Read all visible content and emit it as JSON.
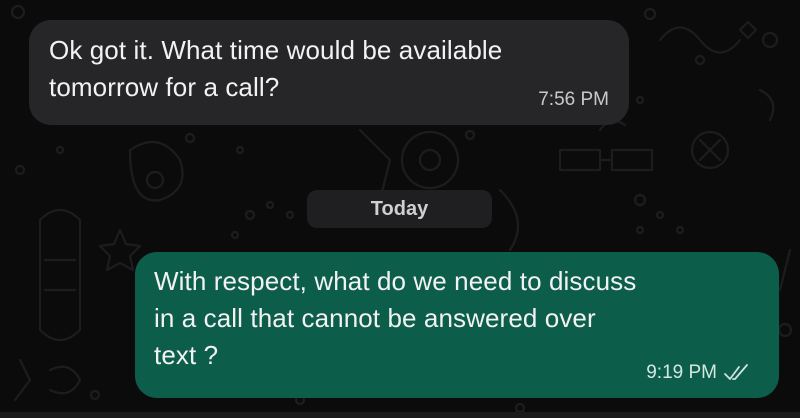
{
  "messages": [
    {
      "direction": "incoming",
      "lines": [
        "Ok got it. What time would be available",
        "tomorrow for a call?"
      ],
      "time": "7:56 PM"
    },
    {
      "direction": "outgoing",
      "lines": [
        "With respect, what do we need to discuss",
        "in a call that cannot be answered over",
        "text ?"
      ],
      "time": "9:19 PM",
      "status_icon": "double-check-icon"
    }
  ],
  "date_separator": "Today",
  "colors": {
    "background": "#0b0b0b",
    "incoming_bubble": "#262628",
    "outgoing_bubble": "#0c5d4a",
    "doodle": "#2a2a2a"
  }
}
